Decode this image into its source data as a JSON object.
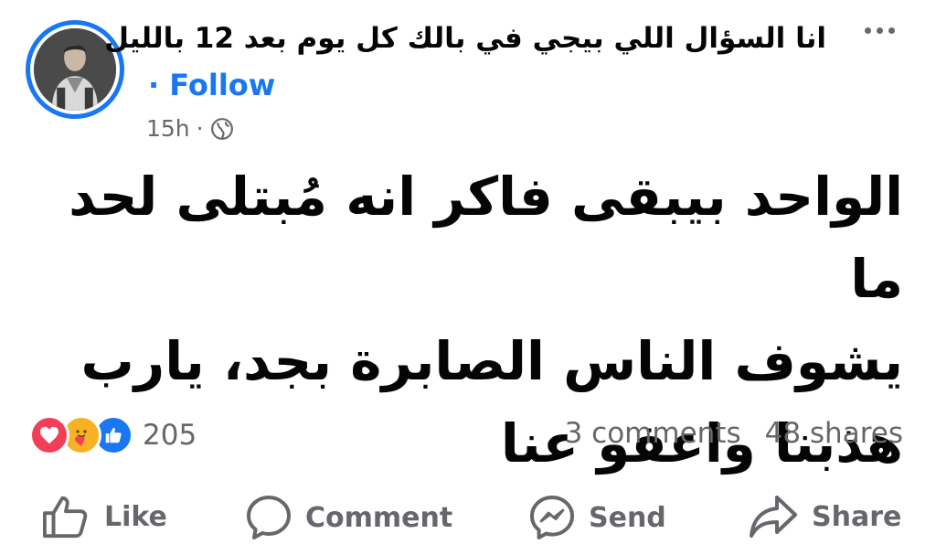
{
  "post": {
    "page_name": "انا السؤال اللي بيجي في بالك كل يوم بعد 12 بالليل",
    "follow_label": "· Follow",
    "time": "15h",
    "meta_separator": "·",
    "text": "الواحد بيبقى فاكر انه مُبتلى لحد ما\nيشوف الناس الصابرة بجد، يارب\nهذبنا واعفو عنا",
    "icons": {
      "more": "more-horizontal-icon",
      "privacy": "globe-icon"
    }
  },
  "engagement": {
    "reactions": [
      "love",
      "care",
      "like"
    ],
    "reaction_count": "205",
    "comments": "3 comments",
    "shares": "48 shares"
  },
  "actions": {
    "like": "Like",
    "comment": "Comment",
    "send": "Send",
    "share": "Share"
  },
  "colors": {
    "accent": "#1877f2",
    "secondary_text": "#65676b",
    "love": "#f33e58",
    "care": "#f7b125"
  }
}
